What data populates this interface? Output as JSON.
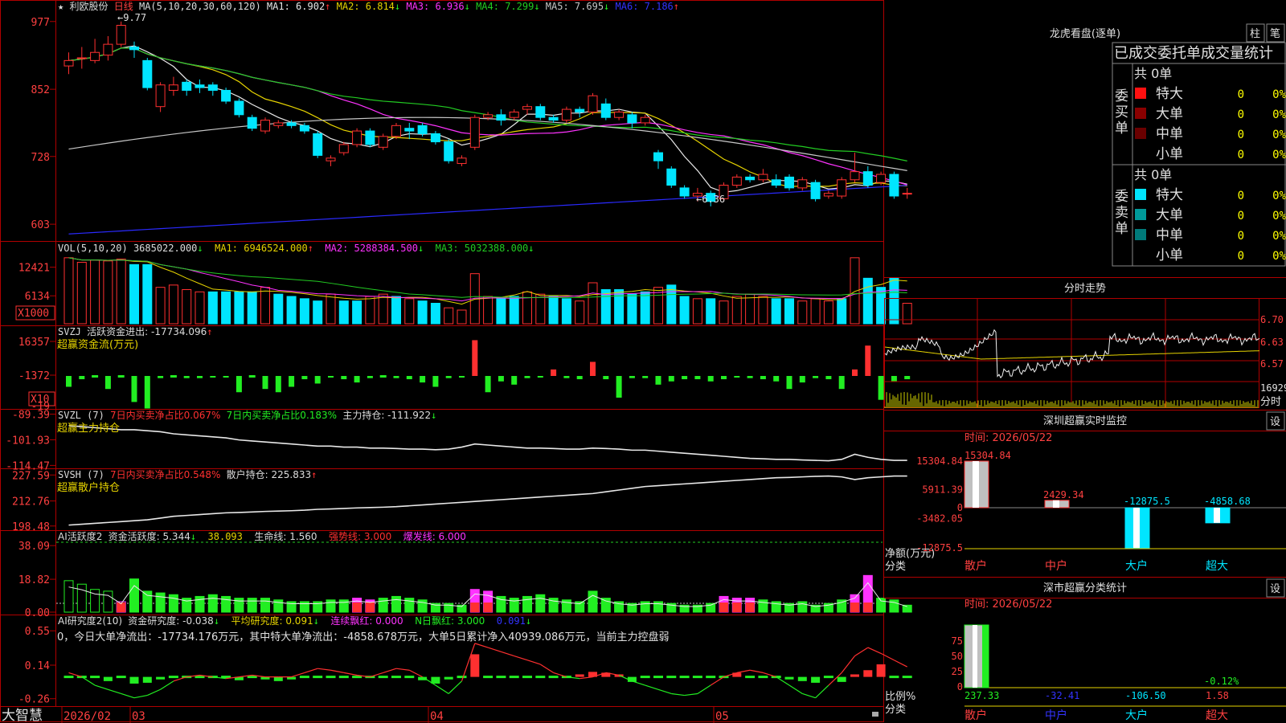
{
  "stock": {
    "name": "利欧股份",
    "period": "日线",
    "star": "★"
  },
  "colors": {
    "up": "#ff3030",
    "down": "#00e5ff",
    "axis": "#b00000",
    "axis_text": "#ff4040",
    "ma1": "#e8e8e8",
    "ma2": "#e6d300",
    "ma3": "#ff33ff",
    "ma4": "#22cc22",
    "ma5": "#c8c8c8",
    "ma6": "#2a2aff",
    "green_bar": "#22ee22",
    "magenta": "#ff33ff"
  },
  "price_panel": {
    "header": {
      "ma_params": "MA(5,10,20,30,60,120)",
      "ma1": "MA1: 6.902",
      "ma1_arrow": "↑",
      "ma2": "MA2: 6.814",
      "ma2_arrow": "↓",
      "ma3": "MA3: 6.936",
      "ma3_arrow": "↓",
      "ma4": "MA4: 7.299",
      "ma4_arrow": "↓",
      "ma5": "MA5: 7.695",
      "ma5_arrow": "↓",
      "ma6": "MA6: 7.186",
      "ma6_arrow": "↑"
    },
    "y_ticks": [
      "977",
      "852",
      "728",
      "603"
    ],
    "hi_label": "←9.77",
    "lo_label": "←6.36",
    "y_range": [
      5.75,
      9.9
    ],
    "candles": [
      [
        8.95,
        9.05,
        8.8,
        9.2
      ],
      [
        9.1,
        9.1,
        8.9,
        9.3
      ],
      [
        9.05,
        9.2,
        9.0,
        9.45
      ],
      [
        9.15,
        9.35,
        9.05,
        9.5
      ],
      [
        9.35,
        9.7,
        9.3,
        9.77
      ],
      [
        9.3,
        9.25,
        9.1,
        9.4
      ],
      [
        9.05,
        8.55,
        8.5,
        9.1
      ],
      [
        8.2,
        8.6,
        8.1,
        8.65
      ],
      [
        8.5,
        8.6,
        8.4,
        8.75
      ],
      [
        8.65,
        8.5,
        8.4,
        8.7
      ],
      [
        8.6,
        8.55,
        8.45,
        8.7
      ],
      [
        8.6,
        8.5,
        8.4,
        8.65
      ],
      [
        8.5,
        8.3,
        8.25,
        8.55
      ],
      [
        8.3,
        8.05,
        8.0,
        8.35
      ],
      [
        8.0,
        7.8,
        7.75,
        8.05
      ],
      [
        7.75,
        7.95,
        7.7,
        8.0
      ],
      [
        7.85,
        7.9,
        7.8,
        7.95
      ],
      [
        7.9,
        7.85,
        7.8,
        7.95
      ],
      [
        7.85,
        7.75,
        7.7,
        7.9
      ],
      [
        7.7,
        7.3,
        7.25,
        7.75
      ],
      [
        7.2,
        7.25,
        7.1,
        7.3
      ],
      [
        7.35,
        7.5,
        7.3,
        7.55
      ],
      [
        7.5,
        7.75,
        7.45,
        7.8
      ],
      [
        7.75,
        7.5,
        7.45,
        7.8
      ],
      [
        7.45,
        7.65,
        7.4,
        7.7
      ],
      [
        7.65,
        7.85,
        7.6,
        7.9
      ],
      [
        7.8,
        7.75,
        7.6,
        7.9
      ],
      [
        7.85,
        7.7,
        7.65,
        7.9
      ],
      [
        7.7,
        7.55,
        7.5,
        7.75
      ],
      [
        7.55,
        7.2,
        7.15,
        7.6
      ],
      [
        7.15,
        7.25,
        7.1,
        7.3
      ],
      [
        7.45,
        8.0,
        7.4,
        8.05
      ],
      [
        8.0,
        8.05,
        7.95,
        8.1
      ],
      [
        8.05,
        7.95,
        7.85,
        8.15
      ],
      [
        8.0,
        8.1,
        7.95,
        8.15
      ],
      [
        8.15,
        8.2,
        8.05,
        8.25
      ],
      [
        8.2,
        8.0,
        7.95,
        8.25
      ],
      [
        8.0,
        7.95,
        7.9,
        8.05
      ],
      [
        7.95,
        8.15,
        7.9,
        8.2
      ],
      [
        8.15,
        8.1,
        8.0,
        8.2
      ],
      [
        8.1,
        8.4,
        8.05,
        8.45
      ],
      [
        8.25,
        8.0,
        7.95,
        8.35
      ],
      [
        8.0,
        8.1,
        7.95,
        8.15
      ],
      [
        8.05,
        7.9,
        7.8,
        8.1
      ],
      [
        7.9,
        8.0,
        7.85,
        8.05
      ],
      [
        7.35,
        7.2,
        7.05,
        7.4
      ],
      [
        7.05,
        6.75,
        6.7,
        7.1
      ],
      [
        6.7,
        6.55,
        6.5,
        6.75
      ],
      [
        6.55,
        6.6,
        6.45,
        6.7
      ],
      [
        6.6,
        6.45,
        6.36,
        6.65
      ],
      [
        6.5,
        6.75,
        6.45,
        6.8
      ],
      [
        6.75,
        6.9,
        6.7,
        6.95
      ],
      [
        6.9,
        6.85,
        6.8,
        6.95
      ],
      [
        6.85,
        6.95,
        6.8,
        7.05
      ],
      [
        6.85,
        6.75,
        6.7,
        6.95
      ],
      [
        6.9,
        6.7,
        6.65,
        6.95
      ],
      [
        6.7,
        6.85,
        6.65,
        6.9
      ],
      [
        6.8,
        6.5,
        6.45,
        6.85
      ],
      [
        6.55,
        6.6,
        6.5,
        6.65
      ],
      [
        6.55,
        6.85,
        6.5,
        6.9
      ],
      [
        6.85,
        7.0,
        6.8,
        7.35
      ],
      [
        7.0,
        6.75,
        6.7,
        7.1
      ],
      [
        6.8,
        6.95,
        6.75,
        7.0
      ],
      [
        6.95,
        6.55,
        6.5,
        7.0
      ],
      [
        6.6,
        6.6,
        6.5,
        6.7
      ]
    ]
  },
  "volume_panel": {
    "header": {
      "params": "VOL(5,10,20)",
      "vol": "3685022.000",
      "vol_arrow": "↓",
      "ma1": "MA1: 6946524.000",
      "ma1_arrow": "↑",
      "ma2": "MA2: 5288384.500",
      "ma2_arrow": "↓",
      "ma3": "MA3: 5032388.000",
      "ma3_arrow": "↓"
    },
    "y_ticks": [
      "12421",
      "6134"
    ],
    "unit": "X1000",
    "values": [
      14.5,
      13.5,
      14.0,
      13.8,
      14.2,
      13.0,
      13.0,
      8.0,
      8.5,
      7.5,
      7.0,
      7.0,
      7.0,
      7.0,
      7.0,
      8.0,
      6.5,
      6.0,
      5.5,
      5.0,
      6.5,
      5.0,
      5.0,
      6.0,
      6.5,
      6.0,
      5.5,
      5.0,
      4.5,
      3.5,
      3.0,
      11.0,
      6.0,
      5.5,
      6.0,
      7.0,
      6.5,
      6.0,
      5.5,
      5.0,
      9.0,
      7.5,
      7.5,
      6.5,
      7.0,
      8.0,
      8.5,
      6.0,
      5.5,
      5.5,
      5.0,
      6.0,
      6.5,
      6.0,
      5.5,
      5.5,
      5.0,
      5.5,
      5.0,
      5.5,
      14.5,
      10.0,
      8.0,
      10.0,
      4.5
    ],
    "up_mask": [
      1,
      1,
      1,
      1,
      1,
      0,
      0,
      1,
      1,
      1,
      1,
      0,
      0,
      0,
      0,
      1,
      0,
      0,
      0,
      0,
      1,
      0,
      0,
      1,
      1,
      0,
      1,
      0,
      0,
      1,
      1,
      1,
      1,
      0,
      0,
      1,
      1,
      0,
      0,
      1,
      1,
      0,
      0,
      0,
      0,
      1,
      0,
      0,
      1,
      0,
      1,
      1,
      1,
      1,
      0,
      0,
      1,
      1,
      1,
      0,
      1,
      0,
      0,
      0,
      1
    ]
  },
  "svzj_panel": {
    "header": {
      "name": "SVZJ",
      "label": "活跃资金进出: -17734.096",
      "arrow": "↑",
      "sub": "超赢资金流(万元)"
    },
    "y_ticks": [
      "16357",
      "-1372",
      "-19"
    ],
    "unit": "X10",
    "values": [
      -10,
      -3,
      0,
      -12,
      0,
      -24,
      -30,
      -2,
      0,
      -2,
      -2,
      -1,
      -1,
      -15,
      0,
      -12,
      -15,
      -10,
      -3,
      -7,
      -1,
      -3,
      -6,
      -2,
      0,
      -2,
      -3,
      -6,
      -10,
      -2,
      -1,
      33,
      -15,
      -5,
      -8,
      -2,
      -1,
      6,
      -2,
      -3,
      13,
      -3,
      -20,
      -2,
      -2,
      -8,
      -5,
      -3,
      -3,
      -5,
      -3,
      -1,
      -2,
      -3,
      -5,
      -12,
      -6,
      -2,
      -3,
      -12,
      6,
      28,
      -22,
      -5,
      -3
    ],
    "zero": -1372,
    "range": [
      -19000,
      16357
    ]
  },
  "svzl_panel": {
    "header": {
      "name": "SVZL (7)",
      "p1": "7日内买卖净占比0.067%",
      "p2": "7日内买卖净占比0.183%",
      "p3": "主力持仓: -111.922",
      "p3_arrow": "↓",
      "sub": "超赢主力持仓"
    },
    "y_ticks": [
      "-89.39",
      "-101.93",
      "-114.47"
    ],
    "values": [
      -95,
      -95.5,
      -96,
      -96.5,
      -97,
      -97,
      -97.5,
      -98,
      -99,
      -99.5,
      -100,
      -100.5,
      -101,
      -102,
      -102.5,
      -103,
      -103.5,
      -104,
      -104.5,
      -105,
      -105,
      -105.5,
      -105.5,
      -106,
      -106,
      -106.2,
      -106.5,
      -106.5,
      -106.8,
      -106.5,
      -105.5,
      -104,
      -104.5,
      -105,
      -105.5,
      -106,
      -106,
      -106.2,
      -106.5,
      -106.5,
      -106,
      -106.2,
      -106.5,
      -107,
      -107,
      -107.5,
      -108,
      -108.5,
      -109,
      -109.5,
      -110,
      -110.5,
      -111,
      -111.2,
      -111.5,
      -111.5,
      -111.8,
      -112,
      -112.2,
      -111.5,
      -109,
      -110.5,
      -111.5,
      -112,
      -112
    ],
    "range": [
      -115.5,
      -88
    ]
  },
  "svsh_panel": {
    "header": {
      "name": "SVSH (7)",
      "p1": "7日内买卖净占比0.548%",
      "p2": "散户持仓: 225.833",
      "p2_arrow": "↑",
      "sub": "超赢散户持仓"
    },
    "y_ticks": [
      "227.59",
      "212.76",
      "198.48"
    ],
    "values": [
      199,
      199.5,
      200,
      200.5,
      201,
      201.5,
      202,
      203,
      204,
      204.5,
      205,
      205.5,
      206,
      206.2,
      206.5,
      206.8,
      207,
      207.2,
      207.5,
      208,
      208.2,
      208.5,
      208.8,
      209,
      209.2,
      209.5,
      210,
      210.5,
      211,
      211.5,
      212,
      212.5,
      213,
      213.5,
      214,
      214.5,
      215,
      215.5,
      216,
      216.5,
      217,
      218,
      219,
      220,
      221,
      221.5,
      222,
      222.5,
      223,
      223.5,
      224,
      224.5,
      225,
      225.5,
      226,
      226.2,
      226.5,
      226.8,
      227,
      226.5,
      225,
      226,
      226.5,
      227,
      227
    ],
    "range": [
      197,
      230
    ]
  },
  "ai1_panel": {
    "header": {
      "name": "AI活跃度2",
      "p1": "资金活跃度: 5.344",
      "p1_arrow": "↓",
      "p2": "38.093",
      "p3": "生命线: 1.560",
      "p4": "强势线: 3.000",
      "p5": "爆发线: 6.000"
    },
    "y_ticks": [
      "38.09",
      "18.82",
      "0.00"
    ],
    "values": [
      18,
      16,
      13,
      12,
      6,
      19,
      12,
      11,
      10,
      8,
      9,
      10,
      9,
      8,
      8,
      8,
      7,
      6,
      6,
      6,
      7,
      7,
      8,
      7,
      8,
      9,
      8,
      7,
      5,
      5,
      4,
      13,
      12,
      9,
      8,
      9,
      10,
      8,
      7,
      6,
      12,
      8,
      6,
      5,
      6,
      6,
      5,
      4,
      4,
      5,
      9,
      8,
      8,
      7,
      6,
      5,
      6,
      4,
      5,
      7,
      10,
      21,
      8,
      7,
      4
    ],
    "magenta_mask": [
      0,
      0,
      0,
      0,
      1,
      0,
      0,
      0,
      0,
      0,
      0,
      0,
      0,
      0,
      0,
      0,
      0,
      0,
      0,
      0,
      0,
      0,
      1,
      1,
      0,
      0,
      0,
      0,
      0,
      0,
      0,
      1,
      1,
      0,
      0,
      0,
      0,
      0,
      0,
      0,
      0,
      0,
      0,
      0,
      0,
      0,
      0,
      0,
      0,
      0,
      1,
      1,
      1,
      0,
      0,
      0,
      0,
      0,
      0,
      0,
      1,
      1,
      0,
      0,
      0
    ],
    "range": [
      0,
      40
    ]
  },
  "ai2_panel": {
    "header": {
      "name": "AI研究度2(10)",
      "p1": "资金研究度: -0.038",
      "p1_arrow": "↓",
      "p2": "平均研究度: 0.091",
      "p2_arrow": "↓",
      "p3": "连续飘红: 0.000",
      "p4": "N日飘红: 3.000",
      "p5": "0.091",
      "p5_arrow": "↓"
    },
    "comment": "0，今日大单净流出：-17734.176万元，其中特大单净流出：-4858.678万元，大单5日累计净入40939.086万元，当前主力控盘弱",
    "y_ticks": [
      "0.55",
      "0.14",
      "-0.26"
    ],
    "bars": [
      0,
      0,
      0,
      -0.05,
      0,
      -0.08,
      -0.07,
      -0.03,
      0,
      0,
      0,
      0,
      0,
      -0.04,
      0,
      -0.03,
      -0.05,
      -0.03,
      0,
      0,
      0,
      0,
      0,
      0,
      0,
      0,
      0,
      -0.04,
      -0.08,
      -0.03,
      0,
      0.27,
      0,
      0,
      0,
      0,
      0,
      0,
      0,
      0.03,
      0.06,
      0.05,
      0.03,
      -0.06,
      0,
      0,
      0,
      0,
      0,
      0,
      0,
      0.05,
      0,
      0,
      0,
      -0.03,
      -0.05,
      -0.07,
      0,
      -0.06,
      0.03,
      0.08,
      0.15,
      0,
      0
    ],
    "line": [
      0.05,
      0.0,
      -0.1,
      -0.15,
      -0.2,
      -0.25,
      -0.22,
      -0.15,
      -0.05,
      0.0,
      0.02,
      0.0,
      -0.02,
      0.0,
      0.02,
      0.0,
      0.0,
      0.0,
      0.05,
      0.1,
      0.08,
      0.05,
      0.02,
      0.0,
      0.05,
      0.1,
      0.08,
      0.0,
      -0.1,
      -0.2,
      -0.05,
      0.4,
      0.35,
      0.3,
      0.25,
      0.2,
      0.15,
      0.05,
      0.0,
      -0.02,
      0.0,
      0.05,
      0.02,
      -0.05,
      -0.1,
      -0.15,
      -0.2,
      -0.22,
      -0.2,
      -0.1,
      0.0,
      0.05,
      0.08,
      0.05,
      0.0,
      -0.1,
      -0.2,
      -0.25,
      -0.1,
      0.05,
      0.25,
      0.35,
      0.28,
      0.2,
      0.12
    ],
    "range": [
      -0.32,
      0.6
    ]
  },
  "x_axis": {
    "labels": [
      "2026/02",
      "03",
      "04",
      "05"
    ],
    "logo": "大智慧"
  },
  "right_panel": {
    "lhb": {
      "title": "龙虎看盘(逐单)",
      "btn1": "柱",
      "btn2": "笔",
      "tabs": "已成交委托单成交量统计",
      "buy_title": "委买单",
      "sell_title": "委卖单",
      "buy_total": "共 0单",
      "sell_total": "共 0单",
      "buy_rows": [
        {
          "label": "特大",
          "n": "0",
          "p": "0%"
        },
        {
          "label": "大单",
          "n": "0",
          "p": "0%"
        },
        {
          "label": "中单",
          "n": "0",
          "p": "0%"
        },
        {
          "label": "小单",
          "n": "0",
          "p": "0%"
        }
      ],
      "sell_rows": [
        {
          "label": "特大",
          "n": "0",
          "p": "0%"
        },
        {
          "label": "大单",
          "n": "0",
          "p": "0%"
        },
        {
          "label": "中单",
          "n": "0",
          "p": "0%"
        },
        {
          "label": "小单",
          "n": "0",
          "p": "0%"
        }
      ]
    },
    "fenshi": {
      "title": "分时走势",
      "y_ticks": [
        "6.70",
        "6.63",
        "6.57"
      ],
      "vol_label": "16929",
      "vol_unit": "分时"
    },
    "sz_monitor": {
      "title": "深圳超赢实时监控",
      "btn": "设",
      "date": "时间: 2026/05/22",
      "y_ticks": [
        "15304.84",
        "5911.39",
        "0",
        "-3482.05",
        "-12875.5"
      ],
      "ylabel": "净额(万元)",
      "xlabel": "分类",
      "categories": [
        "散户",
        "中户",
        "大户",
        "超大"
      ],
      "values": [
        15304.84,
        2429.34,
        -12875.5,
        -4858.68
      ],
      "value_labels": [
        "15304.84",
        "2429.34",
        "-12875.5",
        "-4858.68"
      ]
    },
    "sz_stats": {
      "title": "深市超赢分类统计",
      "btn": "设",
      "date": "时间: 2026/05/22",
      "y_ticks": [
        "75",
        "50",
        "25",
        "0"
      ],
      "ylabel": "比例%",
      "xlabel": "分类",
      "extra": "-0.12%",
      "categories": [
        "散户",
        "中户",
        "大户",
        "超大"
      ],
      "value_labels": [
        "237.33",
        "-32.41",
        "-106.50",
        "1.58"
      ]
    }
  }
}
